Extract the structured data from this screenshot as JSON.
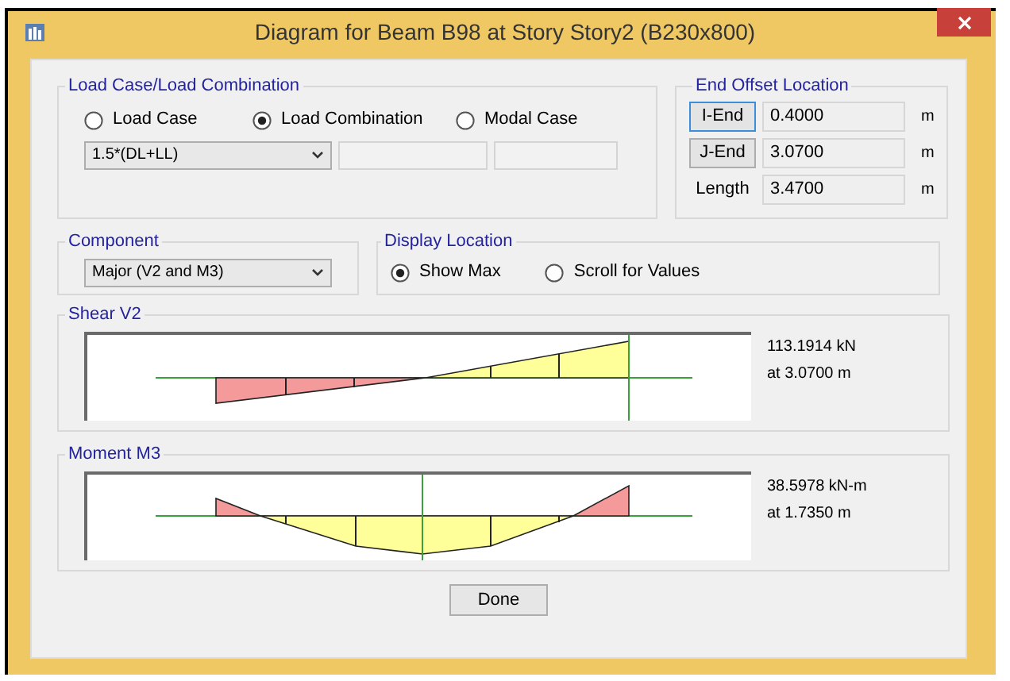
{
  "window": {
    "title": "Diagram for Beam B98 at Story Story2 (B230x800)"
  },
  "load_case_group": {
    "legend": "Load Case/Load Combination",
    "options": [
      {
        "label": "Load Case",
        "selected": false
      },
      {
        "label": "Load Combination",
        "selected": true
      },
      {
        "label": "Modal Case",
        "selected": false
      }
    ],
    "combo": {
      "value": "1.5*(DL+LL)"
    }
  },
  "end_offset": {
    "legend": "End Offset Location",
    "rows": [
      {
        "kind": "button",
        "label": "I-End",
        "value": "0.4000",
        "unit": "m",
        "focused": true
      },
      {
        "kind": "button",
        "label": "J-End",
        "value": "3.0700",
        "unit": "m",
        "focused": false
      },
      {
        "kind": "label",
        "label": "Length",
        "value": "3.4700",
        "unit": "m"
      }
    ]
  },
  "component": {
    "legend": "Component",
    "value": "Major (V2 and M3)"
  },
  "display_location": {
    "legend": "Display Location",
    "options": [
      {
        "label": "Show Max",
        "selected": true
      },
      {
        "label": "Scroll for Values",
        "selected": false
      }
    ]
  },
  "diagrams": [
    {
      "legend": "Shear V2",
      "kind": "shear",
      "readout": [
        "113.1914 kN",
        "at 3.0700 m"
      ]
    },
    {
      "legend": "Moment M3",
      "kind": "moment",
      "readout": [
        "38.5978 kN-m",
        "at 1.7350 m"
      ]
    }
  ],
  "buttons": [
    "Done"
  ]
}
